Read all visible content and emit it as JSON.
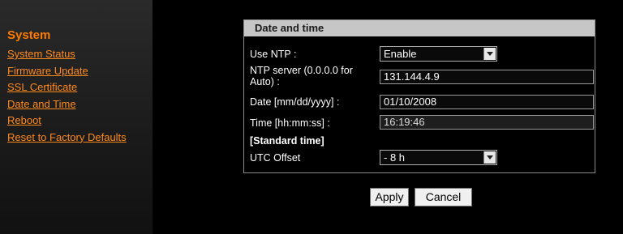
{
  "sidebar": {
    "title": "System",
    "items": [
      {
        "label": "System Status"
      },
      {
        "label": "Firmware Update"
      },
      {
        "label": "SSL Certificate"
      },
      {
        "label": "Date and Time"
      },
      {
        "label": "Reboot"
      },
      {
        "label": "Reset to Factory Defaults"
      }
    ]
  },
  "panel": {
    "title": "Date and time",
    "use_ntp": {
      "label": "Use NTP :",
      "value": "Enable"
    },
    "ntp_server": {
      "label_line1": "NTP server (0.0.0.0 for",
      "label_line2": "Auto) :",
      "value": "131.144.4.9"
    },
    "date": {
      "label": "Date [mm/dd/yyyy] :",
      "value": "01/10/2008"
    },
    "time": {
      "label": "Time [hh:mm:ss] :",
      "value": "16:19:46"
    },
    "standard_time_heading": "[Standard time]",
    "utc_offset": {
      "label": "UTC Offset",
      "value": "- 8 h"
    }
  },
  "buttons": {
    "apply": "Apply",
    "cancel": "Cancel"
  },
  "colors": {
    "accent": "#ff7a00",
    "background": "#000000",
    "header": "#c6c6c6"
  }
}
